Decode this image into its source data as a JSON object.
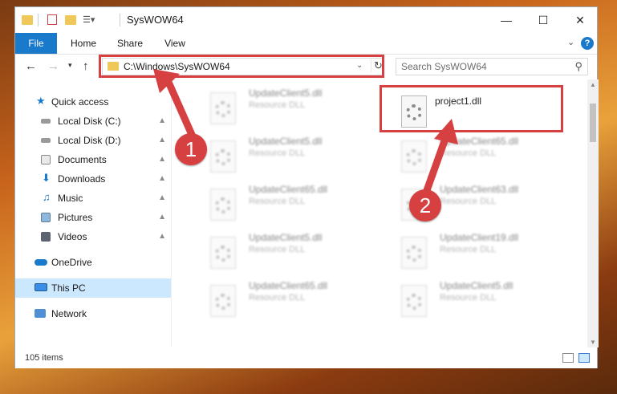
{
  "window": {
    "title": "SysWOW64"
  },
  "ribbon": {
    "tabs": [
      "File",
      "Home",
      "Share",
      "View"
    ],
    "help": "?"
  },
  "navigation": {
    "address": "C:\\Windows\\SysWOW64",
    "search_placeholder": "Search SysWOW64"
  },
  "sidebar": {
    "items": [
      {
        "label": "Quick access",
        "pinned": false
      },
      {
        "label": "Local Disk (C:)",
        "pinned": true
      },
      {
        "label": "Local Disk (D:)",
        "pinned": true
      },
      {
        "label": "Documents",
        "pinned": true
      },
      {
        "label": "Downloads",
        "pinned": true
      },
      {
        "label": "Music",
        "pinned": true
      },
      {
        "label": "Pictures",
        "pinned": true
      },
      {
        "label": "Videos",
        "pinned": true
      },
      {
        "label": "OneDrive",
        "pinned": false
      },
      {
        "label": "This PC",
        "pinned": false,
        "selected": true
      },
      {
        "label": "Network",
        "pinned": false
      }
    ]
  },
  "files": {
    "left": [
      {
        "name": "UpdateClient5.dll",
        "type": "Resource DLL"
      },
      {
        "name": "UpdateClient5.dll",
        "type": "Resource DLL"
      },
      {
        "name": "UpdateClient65.dll",
        "type": "Resource DLL"
      },
      {
        "name": "UpdateClient5.dll",
        "type": "Resource DLL"
      },
      {
        "name": "UpdateClient65.dll",
        "type": "Resource DLL"
      }
    ],
    "right": [
      {
        "name": "project1.dll",
        "type": ""
      },
      {
        "name": "UpdateClient65.dll",
        "type": "Resource DLL"
      },
      {
        "name": "UpdateClient63.dll",
        "type": "Resource DLL"
      },
      {
        "name": "UpdateClient19.dll",
        "type": "Resource DLL"
      },
      {
        "name": "UpdateClient5.dll",
        "type": "Resource DLL"
      }
    ]
  },
  "status": {
    "item_count": "105 items"
  },
  "annotations": {
    "step1": "1",
    "step2": "2",
    "color": "#d64040"
  }
}
